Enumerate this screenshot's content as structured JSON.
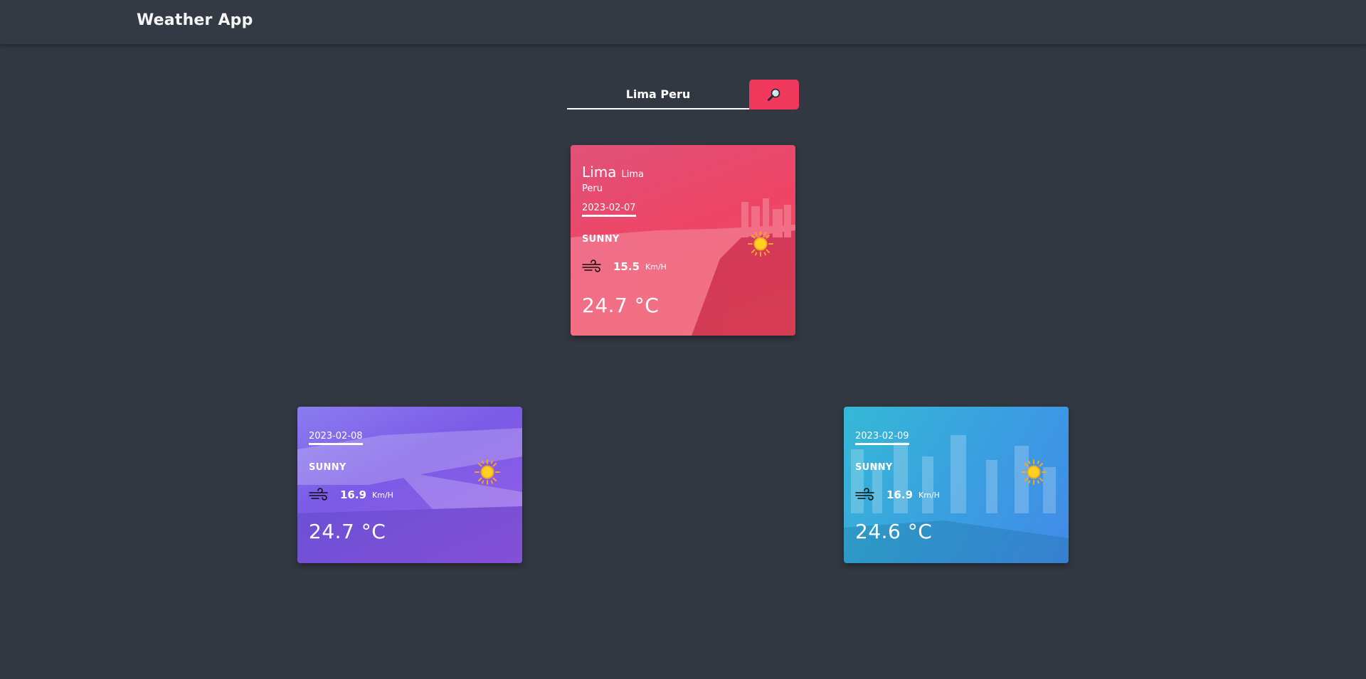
{
  "header": {
    "title": "Weather App"
  },
  "search": {
    "value": "Lima Peru",
    "button_icon": "search-icon"
  },
  "current": {
    "city": "Lima",
    "region": "Lima",
    "country": "Peru",
    "date": "2023-02-07",
    "condition": "SUNNY",
    "wind_speed": "15.5",
    "wind_unit": "Km/H",
    "temperature": "24.7 °C",
    "icon": "sun-icon",
    "color": "#ee4566"
  },
  "forecast": [
    {
      "date": "2023-02-08",
      "condition": "SUNNY",
      "wind_speed": "16.9",
      "wind_unit": "Km/H",
      "temperature": "24.7 °C",
      "icon": "sun-icon",
      "color": "#7a5be6"
    },
    {
      "date": "2023-02-09",
      "condition": "SUNNY",
      "wind_speed": "16.9",
      "wind_unit": "Km/H",
      "temperature": "24.6 °C",
      "icon": "sun-icon",
      "color": "#3aa0e0"
    }
  ],
  "colors": {
    "background": "#323842",
    "accent": "#f0385d"
  }
}
